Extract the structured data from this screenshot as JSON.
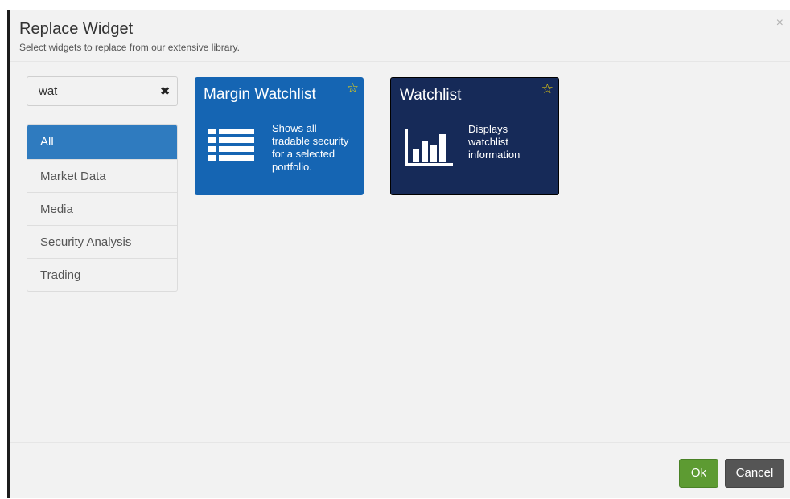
{
  "dialog": {
    "title": "Replace Widget",
    "subtitle": "Select widgets to replace from our extensive library.",
    "close_glyph": "×"
  },
  "search": {
    "value": "wat",
    "clear_glyph": "✖"
  },
  "categories": [
    {
      "label": "All",
      "active": true
    },
    {
      "label": "Market Data",
      "active": false
    },
    {
      "label": "Media",
      "active": false
    },
    {
      "label": "Security Analysis",
      "active": false
    },
    {
      "label": "Trading",
      "active": false
    }
  ],
  "widgets": [
    {
      "title": "Margin Watchlist",
      "description_lines": [
        "Shows all",
        "tradable security",
        "for a selected",
        "portfolio."
      ],
      "icon": "list-icon",
      "favorite_glyph": "☆",
      "color": "#1565b3"
    },
    {
      "title": "Watchlist",
      "description_lines": [
        "Displays",
        "watchlist",
        "information"
      ],
      "icon": "bar-chart-icon",
      "favorite_glyph": "☆",
      "color": "#162a58"
    }
  ],
  "footer": {
    "ok_label": "Ok",
    "cancel_label": "Cancel"
  },
  "colors": {
    "accent": "#2f7bbf",
    "ok": "#5d9b32",
    "cancel": "#555555",
    "star": "#f5d60a"
  }
}
